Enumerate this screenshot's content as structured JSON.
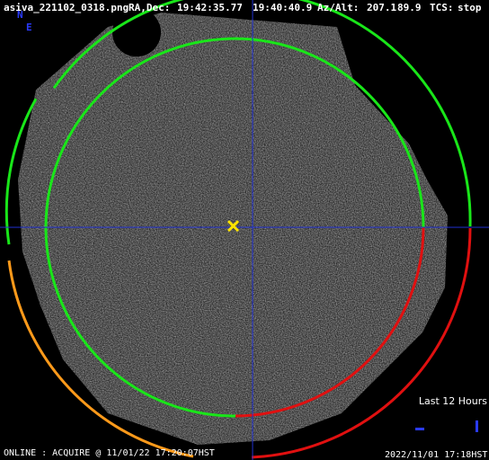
{
  "header": {
    "filename": "asiva_221102_0318.png",
    "radec_label": "RA,Dec:",
    "ra": "19:42:35.77",
    "dec": "19:40:40.9",
    "azalt_label": "Az/Alt:",
    "az": "207.1",
    "alt": "89.9",
    "tcs_label": "TCS:",
    "tcs": "stop"
  },
  "directions": {
    "north": "N",
    "east": "E"
  },
  "legend": {
    "title": "Last 12 Hours"
  },
  "footer": {
    "status": "ONLINE : ACQUIRE @ 11/01/22 17:20:07HST",
    "timestamp": "2022/11/01 17:18HST"
  },
  "colors": {
    "inner_circle": "#19e619",
    "outer_green": "#19e619",
    "outer_orange": "#ff9a1a",
    "outer_red": "#e01010",
    "crosshair": "#1f2fd0",
    "marker": "#ffe400"
  }
}
